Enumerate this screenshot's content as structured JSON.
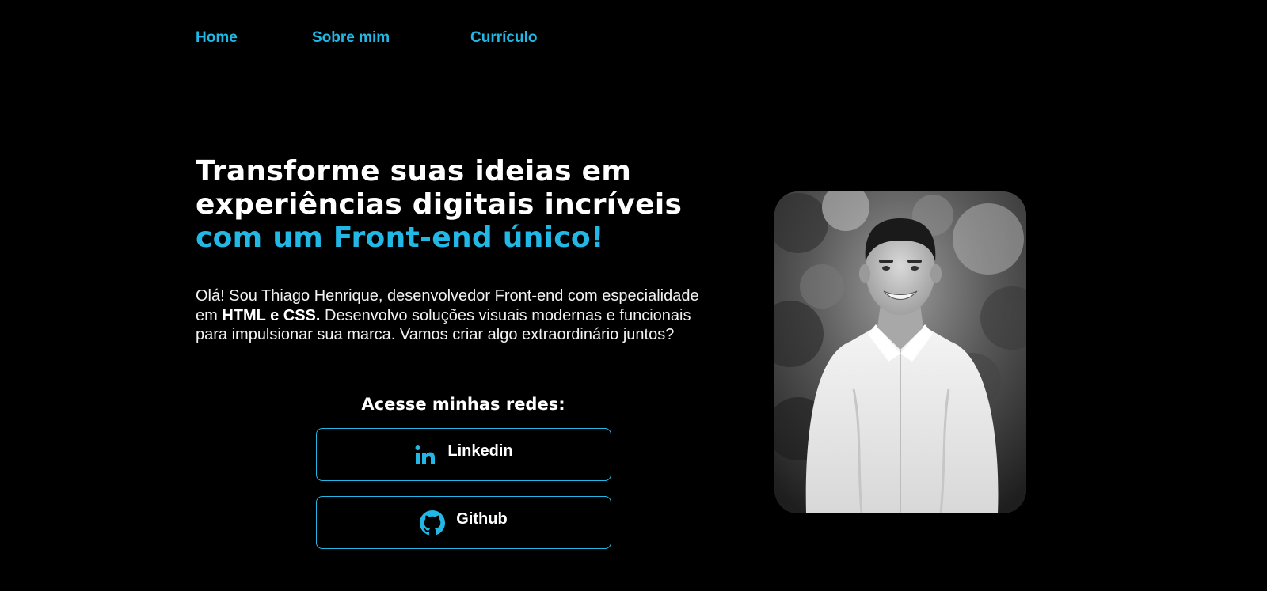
{
  "nav": {
    "items": [
      {
        "label": "Home"
      },
      {
        "label": "Sobre mim"
      },
      {
        "label": "Currículo"
      }
    ]
  },
  "hero": {
    "title_line1": "Transforme suas ideias em",
    "title_line2": "experiências digitais incríveis",
    "title_accent": "com um Front-end único!",
    "intro_part1": "Olá! Sou Thiago Henrique, desenvolvedor Front-end com especialidade em ",
    "intro_bold": "HTML e CSS.",
    "intro_part2": " Desenvolvo soluções visuais modernas e funcionais para impulsionar sua marca. Vamos criar algo extraordinário juntos?"
  },
  "social": {
    "heading": "Acesse minhas redes:",
    "linkedin_label": "Linkedin",
    "linkedin_icon": "linkedin-icon",
    "github_label": "Github",
    "github_icon": "github-icon"
  },
  "colors": {
    "background": "#000000",
    "accent": "#22b8e6",
    "text": "#ffffff"
  }
}
